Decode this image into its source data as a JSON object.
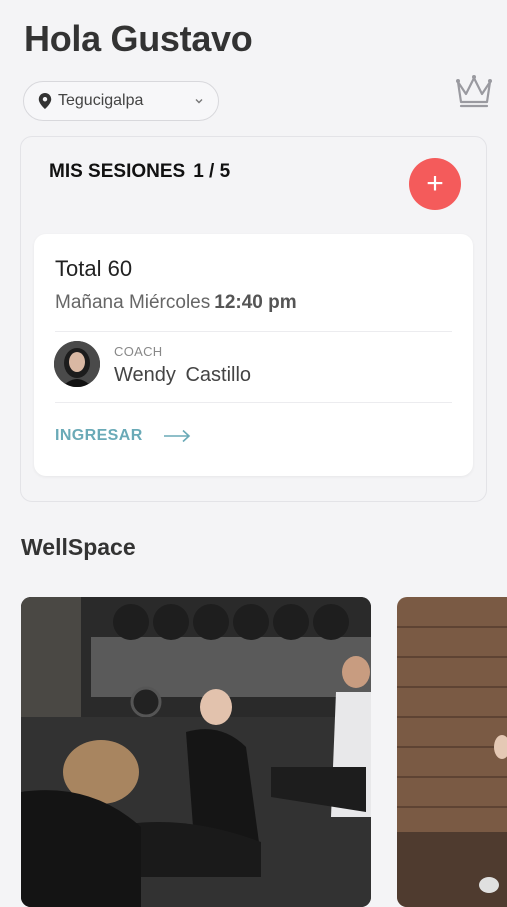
{
  "header": {
    "greeting": "Hola Gustavo"
  },
  "location": {
    "selected": "Tegucigalpa",
    "icon": "location-pin-icon"
  },
  "premium": {
    "icon": "crown-icon"
  },
  "sessions": {
    "title": "MIS SESIONES",
    "count": "1 / 5",
    "add_label": "+",
    "accent": "#f45b5b",
    "card": {
      "class_name": "Total 60",
      "day": "Mañana Miércoles",
      "time": "12:40 pm",
      "coach_label": "COACH",
      "coach_name": "Wendy  Castillo",
      "enter_label": "INGRESAR",
      "enter_color": "#6aaab7"
    }
  },
  "wellspace": {
    "title": "WellSpace",
    "cards": [
      {
        "subject": "group yoga class in gym"
      },
      {
        "subject": "brick wall studio"
      }
    ]
  }
}
